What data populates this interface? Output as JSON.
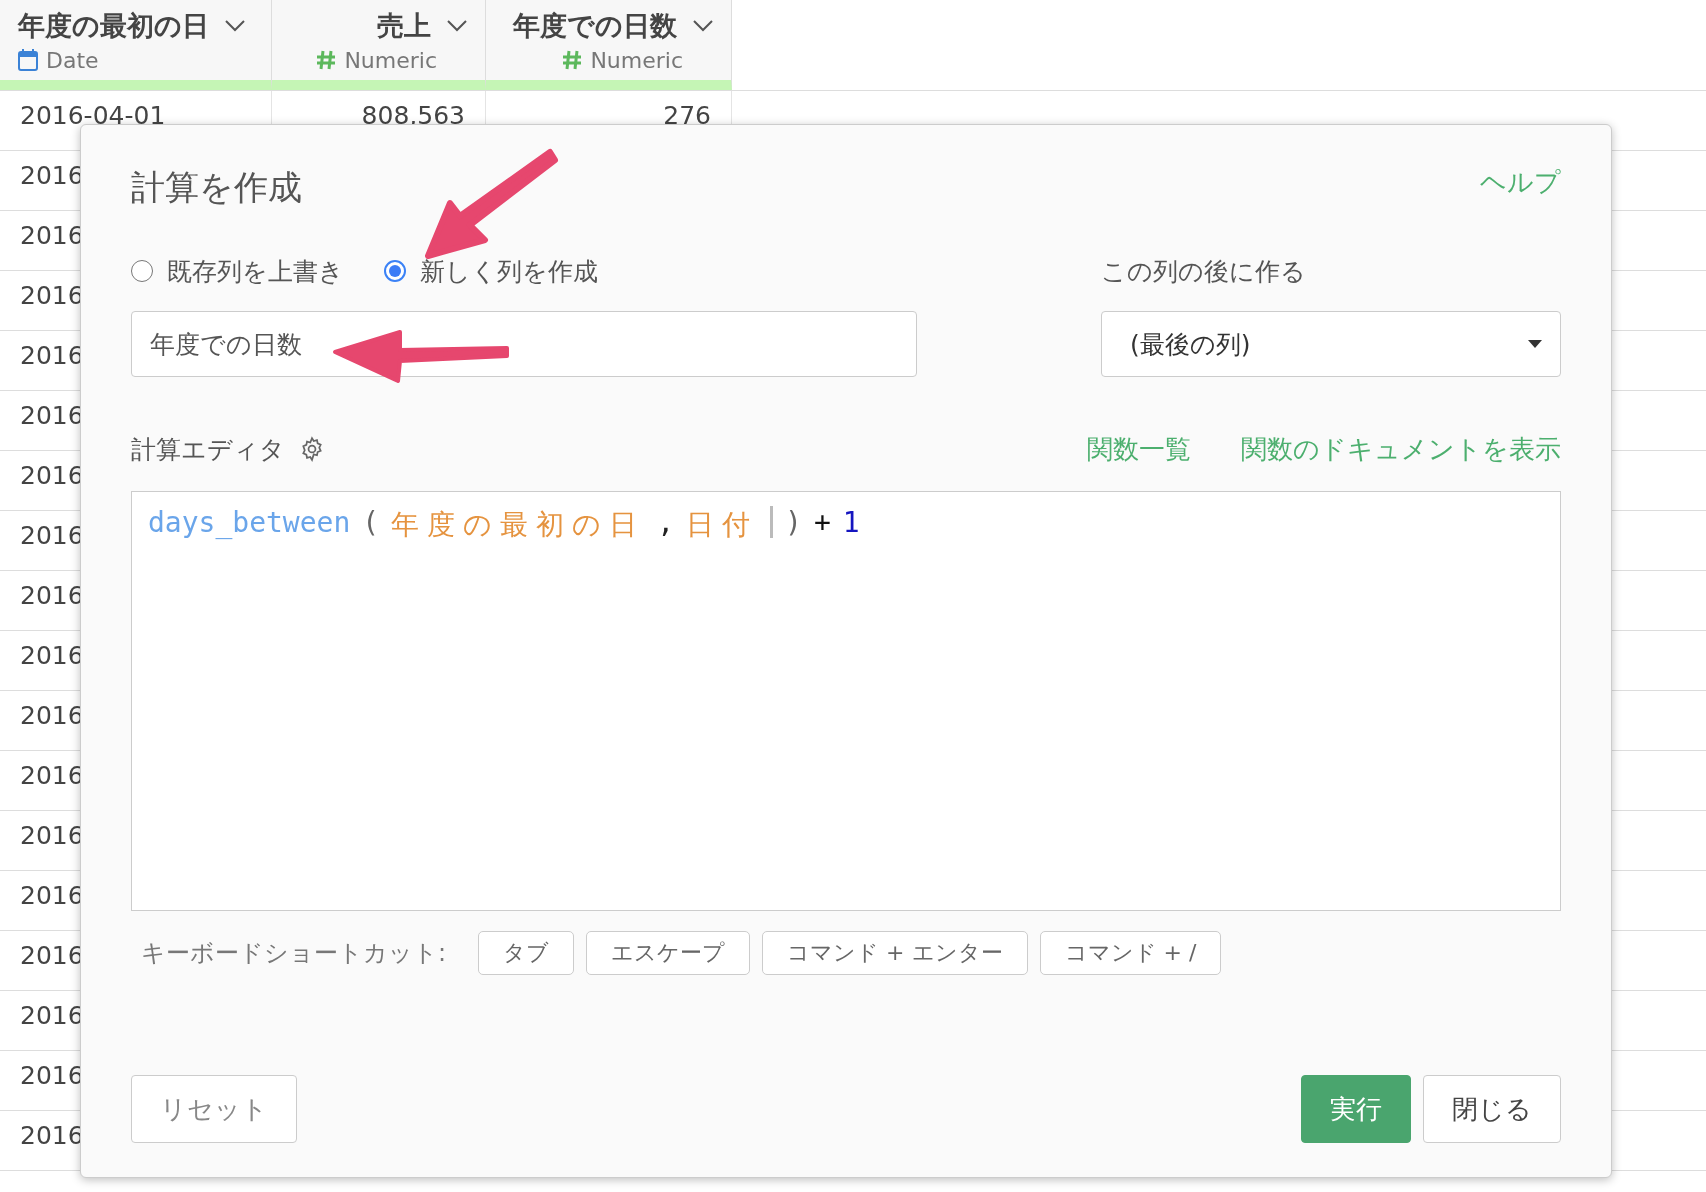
{
  "table": {
    "columns": [
      {
        "title": "年度の最初の日",
        "type": "Date",
        "kind": "date"
      },
      {
        "title": "売上",
        "type": "Numeric",
        "kind": "numeric"
      },
      {
        "title": "年度での日数",
        "type": "Numeric",
        "kind": "numeric"
      }
    ],
    "rows": [
      [
        "2016-04-01",
        "808,563",
        "276"
      ],
      [
        "2016"
      ],
      [
        "2016"
      ],
      [
        "2016"
      ],
      [
        "2016"
      ],
      [
        "2016"
      ],
      [
        "2016"
      ],
      [
        "2016"
      ],
      [
        "2016"
      ],
      [
        "2016"
      ],
      [
        "2016"
      ],
      [
        "2016"
      ],
      [
        "2016"
      ],
      [
        "2016"
      ],
      [
        "2016"
      ],
      [
        "2016"
      ],
      [
        "2016"
      ],
      [
        "2016"
      ]
    ]
  },
  "dialog": {
    "title": "計算を作成",
    "help_link": "ヘルプ",
    "mode_options": [
      {
        "label": "既存列を上書き",
        "selected": false
      },
      {
        "label": "新しく列を作成",
        "selected": true
      }
    ],
    "name_field": {
      "value": "年度での日数"
    },
    "position_label": "この列の後に作る",
    "position_select": {
      "value": "(最後の列)"
    },
    "editor_label": "計算エディタ",
    "editor_links": [
      "関数一覧",
      "関数のドキュメントを表示"
    ],
    "editor_tokens": [
      {
        "text": "days_between",
        "kind": "function"
      },
      {
        "text": "(",
        "kind": "paren"
      },
      {
        "text": "年度の最初の日",
        "kind": "column"
      },
      {
        "text": ",",
        "kind": "punct"
      },
      {
        "text": "日付",
        "kind": "column"
      },
      {
        "text": ")",
        "kind": "paren"
      },
      {
        "text": "+",
        "kind": "operator"
      },
      {
        "text": "1",
        "kind": "number"
      }
    ],
    "shortcuts_label": "キーボードショートカット:",
    "shortcuts": [
      "タブ",
      "エスケープ",
      "コマンド + エンター",
      "コマンド + /"
    ],
    "buttons": {
      "reset": "リセット",
      "run": "実行",
      "close": "閉じる"
    }
  }
}
